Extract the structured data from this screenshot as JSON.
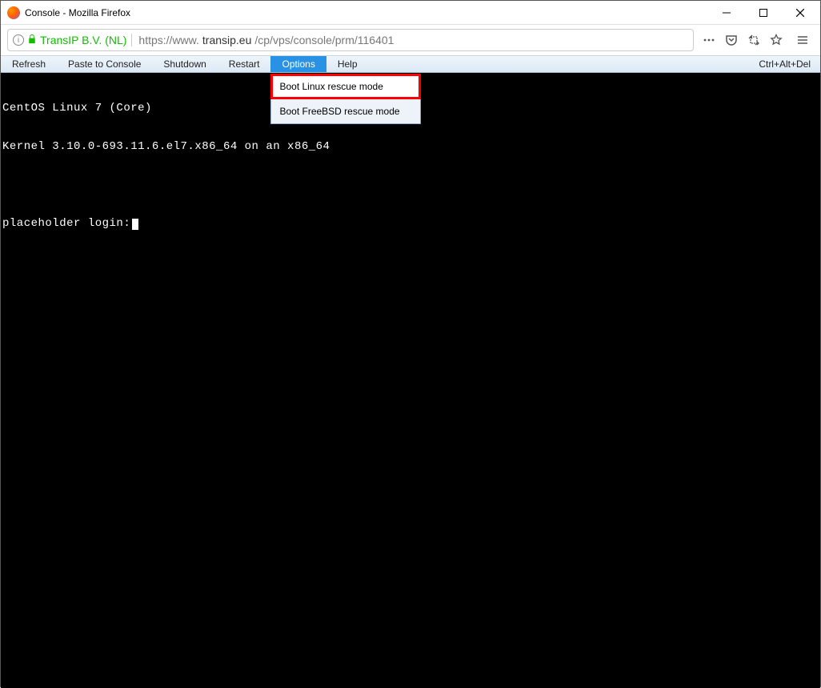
{
  "titlebar": {
    "title": "Console - Mozilla Firefox"
  },
  "addressbar": {
    "identity": "TransIP B.V. (NL)",
    "url_prefix": "https://www.",
    "url_host": "transip.eu",
    "url_path": "/cp/vps/console/prm/116401"
  },
  "menubar": {
    "items": [
      "Refresh",
      "Paste to Console",
      "Shutdown",
      "Restart",
      "Options",
      "Help"
    ],
    "right": "Ctrl+Alt+Del",
    "active_index": 4
  },
  "dropdown": {
    "items": [
      {
        "label": "Boot Linux rescue mode",
        "highlighted": true
      },
      {
        "label": "Boot FreeBSD rescue mode",
        "highlighted": false
      }
    ]
  },
  "terminal": {
    "lines": [
      "CentOS Linux 7 (Core)",
      "Kernel 3.10.0-693.11.6.el7.x86_64 on an x86_64",
      "",
      "placeholder login:"
    ]
  }
}
